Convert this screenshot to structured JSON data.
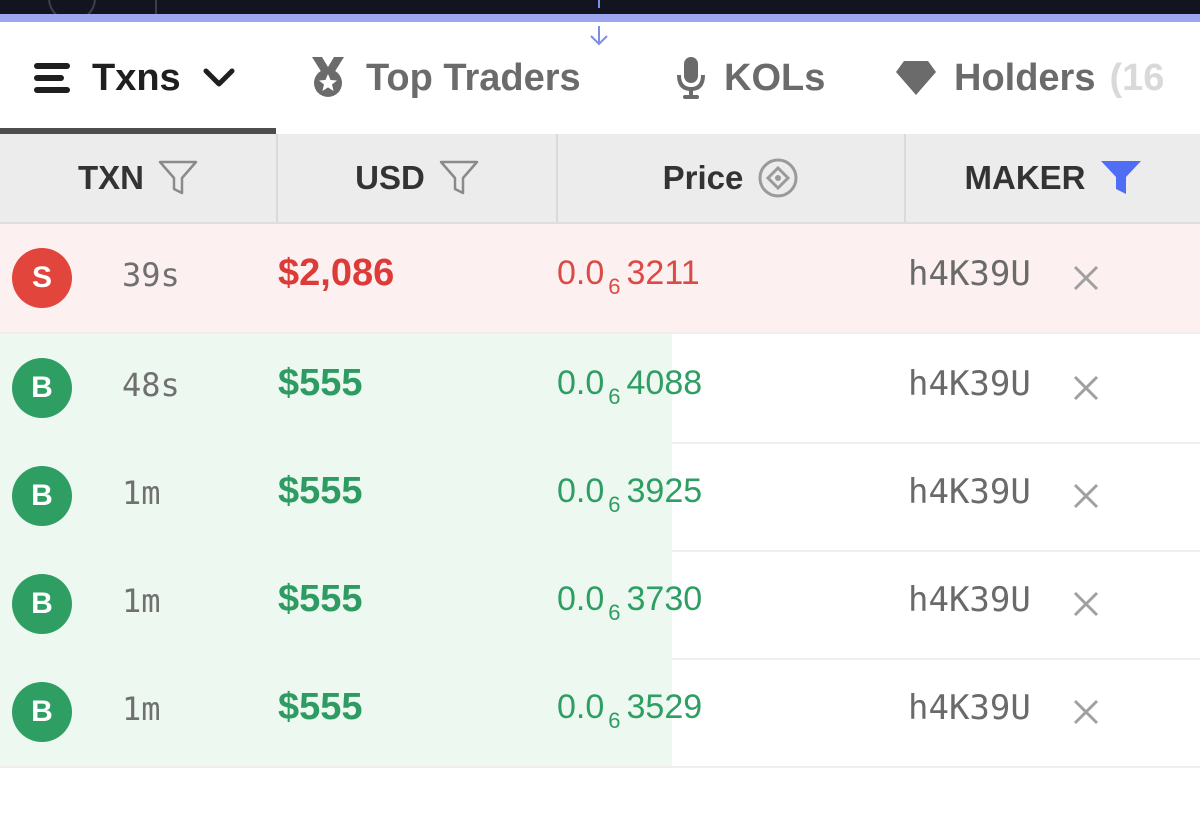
{
  "tabs": [
    {
      "label": "Txns",
      "icon": "list-icon",
      "active": true
    },
    {
      "label": "Top Traders",
      "icon": "medal-icon"
    },
    {
      "label": "KOLs",
      "icon": "microphone-icon"
    },
    {
      "label": "Holders",
      "count_visible": "(16",
      "icon": "diamond-icon"
    }
  ],
  "table": {
    "headers": {
      "txn": "TXN",
      "usd": "USD",
      "price": "Price",
      "maker": "MAKER"
    },
    "rows": [
      {
        "type": "S",
        "kind": "sell",
        "age": "39s",
        "usd": "$2,086",
        "price_prefix": "0.0",
        "price_zeros": "6",
        "price_digits": "3211",
        "maker": "h4K39U",
        "volume_fill": 1.0
      },
      {
        "type": "B",
        "kind": "buy",
        "age": "48s",
        "usd": "$555",
        "price_prefix": "0.0",
        "price_zeros": "6",
        "price_digits": "4088",
        "maker": "h4K39U",
        "volume_fill": 0.56
      },
      {
        "type": "B",
        "kind": "buy",
        "age": "1m",
        "usd": "$555",
        "price_prefix": "0.0",
        "price_zeros": "6",
        "price_digits": "3925",
        "maker": "h4K39U",
        "volume_fill": 0.56
      },
      {
        "type": "B",
        "kind": "buy",
        "age": "1m",
        "usd": "$555",
        "price_prefix": "0.0",
        "price_zeros": "6",
        "price_digits": "3730",
        "maker": "h4K39U",
        "volume_fill": 0.56
      },
      {
        "type": "B",
        "kind": "buy",
        "age": "1m",
        "usd": "$555",
        "price_prefix": "0.0",
        "price_zeros": "6",
        "price_digits": "3529",
        "maker": "h4K39U",
        "volume_fill": 0.56
      }
    ]
  },
  "colors": {
    "buy": "#2e9e63",
    "sell": "#e2453c",
    "active_filter": "#4f6df5",
    "accent_line": "#9ba6ef"
  }
}
